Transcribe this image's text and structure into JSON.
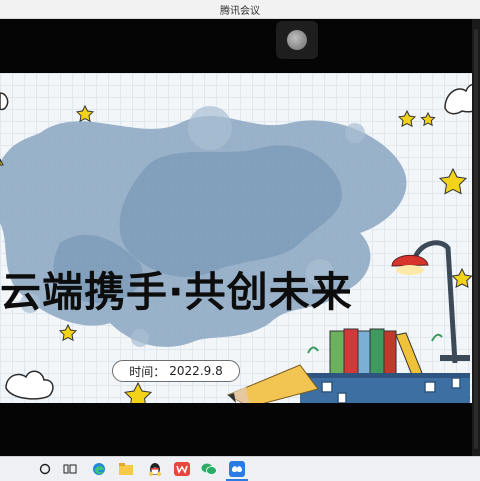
{
  "window": {
    "title": "腾讯会议"
  },
  "slide": {
    "title": "云端携手·共创未来",
    "date_label": "时间：",
    "date_value": "2022.9.8"
  },
  "taskbar": {
    "icons": [
      "search-icon",
      "task-view-icon",
      "edge-icon",
      "file-explorer-icon",
      "tencent-qq-icon",
      "wps-office-icon",
      "wechat-icon",
      "tencent-meeting-icon"
    ]
  },
  "colors": {
    "titlebar": "#f2f2f2",
    "video_bg": "#050505",
    "slide_bg": "#f3f6f9",
    "watercolor": "#7f9db9",
    "star": "#f3d21a",
    "book_red": "#d23a3a",
    "book_green": "#3f9a5f"
  }
}
